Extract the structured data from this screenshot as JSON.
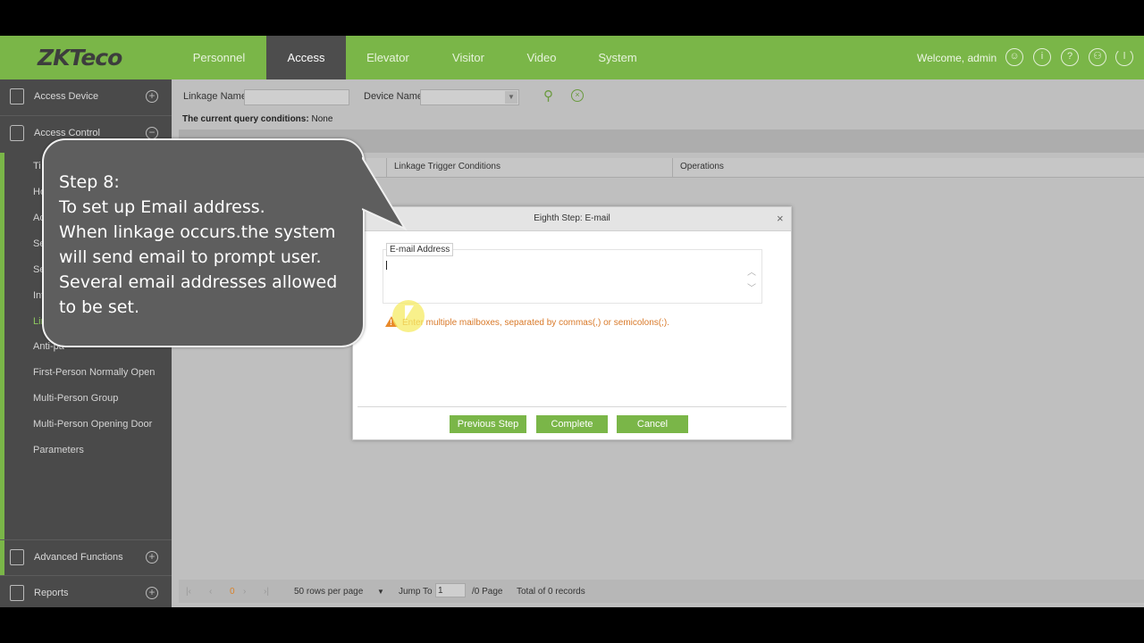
{
  "app": {
    "logo": "ZKTeco",
    "welcome": "Welcome, admin"
  },
  "nav": {
    "tabs": [
      "Personnel",
      "Access",
      "Elevator",
      "Visitor",
      "Video",
      "System"
    ],
    "active": "Access"
  },
  "sidebar": {
    "sections": {
      "access_device": "Access Device",
      "access_control": "Access Control",
      "advanced_functions": "Advanced Functions",
      "reports": "Reports"
    },
    "partial_items": [
      "Ti",
      "Ho",
      "Ac",
      "Se",
      "Se",
      "Int",
      "Lin",
      "Anti-pa"
    ],
    "items": [
      "First-Person Normally Open",
      "Multi-Person Group",
      "Multi-Person Opening Door",
      "Parameters"
    ]
  },
  "filters": {
    "linkage_name_label": "Linkage Name",
    "device_name_label": "Device Name",
    "query_label": "The current query conditions:",
    "query_value": "None"
  },
  "table": {
    "columns": [
      "Linkage Trigger Conditions",
      "Operations"
    ]
  },
  "pager": {
    "current_page": "0",
    "rows_per_page": "50 rows per page",
    "jump_to_label": "Jump To",
    "jump_to_value": "1",
    "page_total": "/0 Page",
    "records": "Total of 0 records"
  },
  "dialog": {
    "title": "Eighth Step: E-mail",
    "close": "×",
    "email_label": "E-mail Address",
    "email_value": "",
    "hint": "Enter multiple mailboxes, separated by commas(,) or semicolons(;).",
    "buttons": {
      "previous": "Previous Step",
      "complete": "Complete",
      "cancel": "Cancel"
    }
  },
  "callout": {
    "lines": [
      "Step 8:",
      "To set up Email address.",
      "When linkage occurs.the system",
      "will send email to prompt user.",
      "Several email addresses allowed",
      "to be set."
    ]
  },
  "colors": {
    "brand_green": "#7ab648",
    "sidebar": "#4a4a4a",
    "warning": "#e8892a"
  },
  "icons": [
    "search-icon",
    "clear-icon",
    "user-icon",
    "info-icon",
    "help-icon",
    "account-icon",
    "power-icon",
    "warning-icon"
  ]
}
